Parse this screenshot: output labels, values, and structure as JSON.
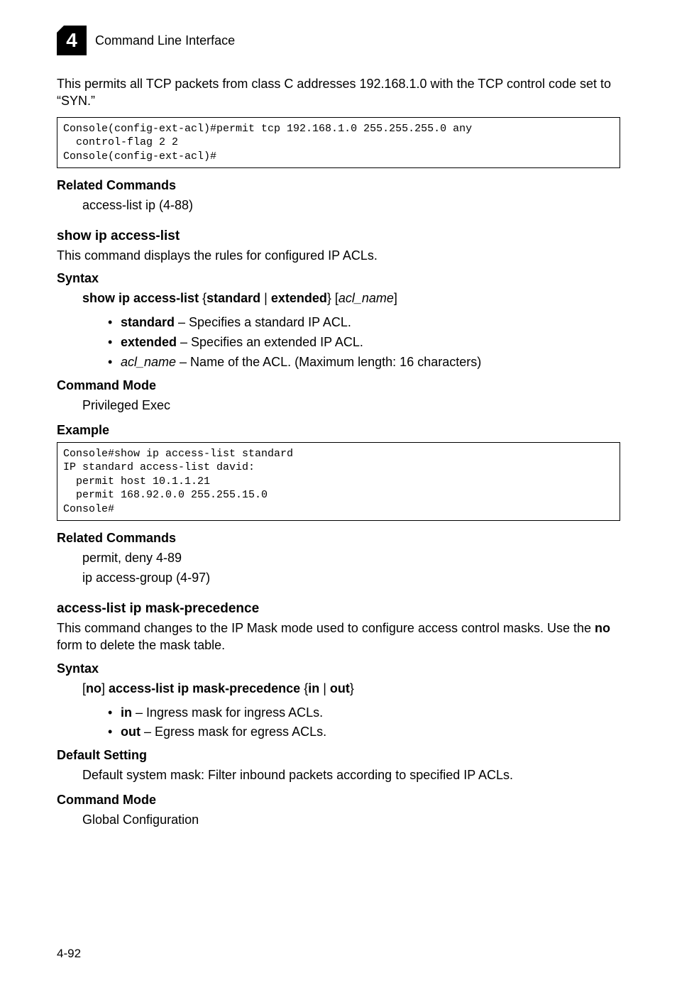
{
  "header": {
    "chapterNumber": "4",
    "title": "Command Line Interface"
  },
  "intro": {
    "para": "This permits all TCP packets from class C addresses 192.168.1.0 with the TCP control code set to “SYN.”"
  },
  "code1": "Console(config-ext-acl)#permit tcp 192.168.1.0 255.255.255.0 any\n  control-flag 2 2\nConsole(config-ext-acl)#",
  "related1": {
    "heading": "Related Commands",
    "line": "access-list ip (4-88)"
  },
  "cmd1": {
    "name": "show ip access-list",
    "desc": "This command displays the rules for configured IP ACLs.",
    "syntaxHeading": "Syntax",
    "syntax": {
      "prefix": "show ip access-list",
      "brace1": " {",
      "opt1": "standard",
      "pipe": " | ",
      "opt2": "extended",
      "brace2": "} [",
      "arg": "acl_name",
      "brace3": "]"
    },
    "bullets": {
      "b1_bold": "standard",
      "b1_rest": " – Specifies a standard IP ACL.",
      "b2_bold": "extended",
      "b2_rest": " – Specifies an extended IP ACL.",
      "b3_ital": "acl_name",
      "b3_rest": " – Name of the ACL. (Maximum length: 16 characters)"
    },
    "modeHeading": "Command Mode",
    "modeLine": "Privileged Exec",
    "exampleHeading": "Example"
  },
  "code2": "Console#show ip access-list standard\nIP standard access-list david:\n  permit host 10.1.1.21\n  permit 168.92.0.0 255.255.15.0\nConsole#",
  "related2": {
    "heading": "Related Commands",
    "line1": "permit, deny 4-89",
    "line2": "ip access-group (4-97)"
  },
  "cmd2": {
    "name": "access-list ip mask-precedence",
    "desc_p1": "This command changes to the IP Mask mode used to configure access control masks. Use the ",
    "desc_bold": "no",
    "desc_p2": " form to delete the mask table.",
    "syntaxHeading": "Syntax",
    "syntax": {
      "lb": "[",
      "no": "no",
      "rb": "] ",
      "mid": "access-list ip mask-precedence",
      "brace1": " {",
      "opt1": "in",
      "pipe": " | ",
      "opt2": "out",
      "brace2": "}"
    },
    "bullets": {
      "b1_bold": "in",
      "b1_rest": " – Ingress mask for ingress ACLs.",
      "b2_bold": "out",
      "b2_rest": " – Egress mask for egress ACLs."
    },
    "defaultHeading": "Default Setting",
    "defaultLine": "Default system mask: Filter inbound packets according to specified IP ACLs.",
    "modeHeading": "Command Mode",
    "modeLine": "Global Configuration"
  },
  "pageNumber": "4-92"
}
